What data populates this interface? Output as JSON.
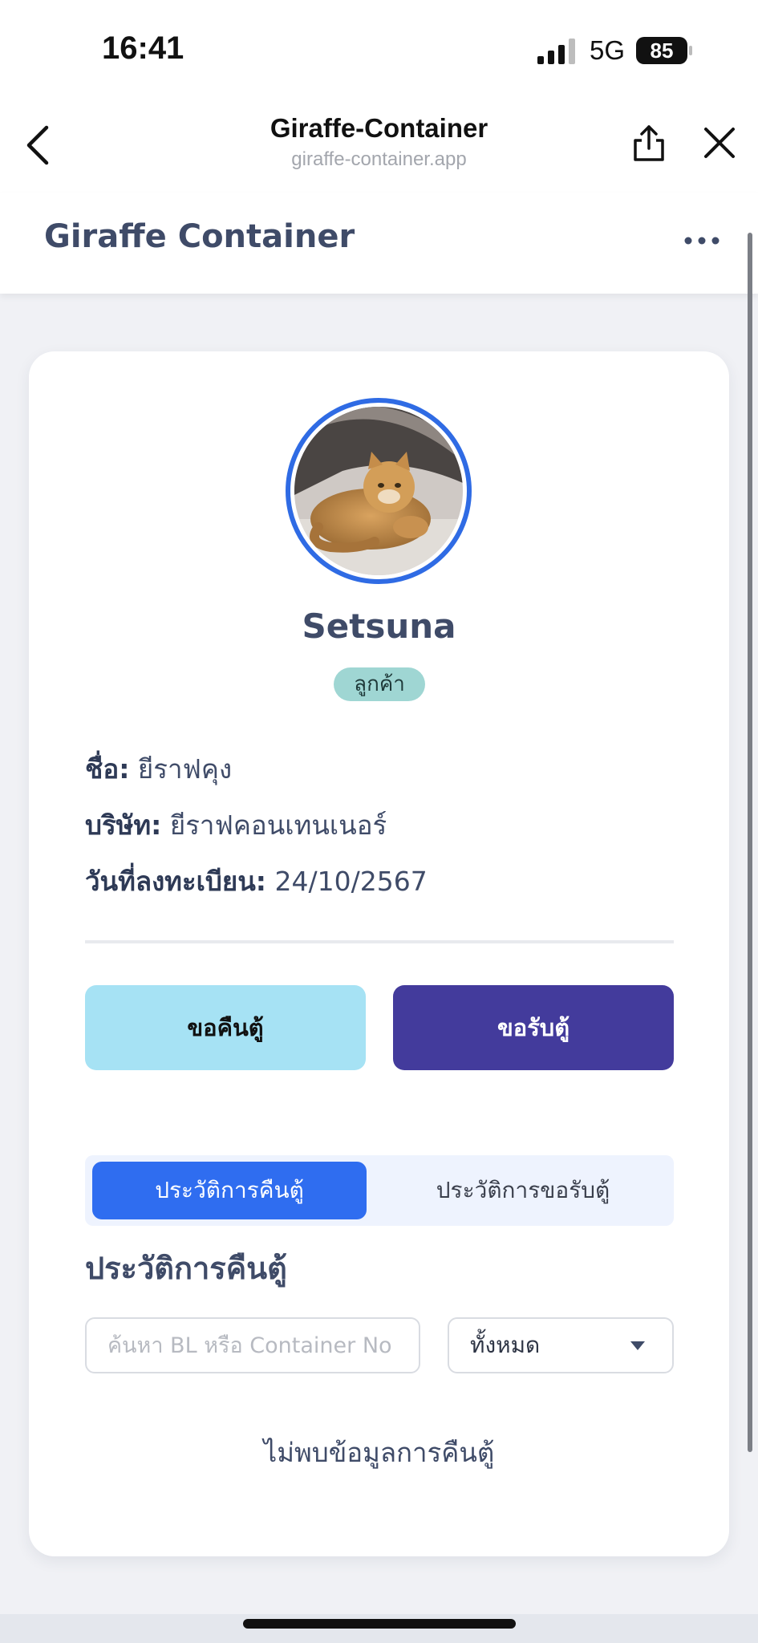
{
  "status_bar": {
    "time": "16:41",
    "network": "5G",
    "battery": "85"
  },
  "browser": {
    "title": "Giraffe-Container",
    "url": "giraffe-container.app",
    "icons": {
      "back": "chevron-left-icon",
      "share": "share-icon",
      "close": "close-icon"
    }
  },
  "app_header": {
    "title": "Giraffe Container",
    "more_icon": "more-horizontal-icon"
  },
  "profile": {
    "username": "Setsuna",
    "role": "ลูกค้า",
    "info": {
      "name_label": "ชื่อ:",
      "name_value": "ยีราฟคุง",
      "company_label": "บริษัท:",
      "company_value": "ยีราฟคอนเทนเนอร์",
      "registered_label": "วันที่ลงทะเบียน:",
      "registered_value": "24/10/2567"
    }
  },
  "actions": {
    "return_label": "ขอคืนตู้",
    "request_label": "ขอรับตู้"
  },
  "tabs": [
    {
      "label": "ประวัติการคืนตู้",
      "active": true
    },
    {
      "label": "ประวัติการขอรับตู้",
      "active": false
    }
  ],
  "history": {
    "title": "ประวัติการคืนตู้",
    "search_placeholder": "ค้นหา BL หรือ Container No",
    "filter_value": "ทั้งหมด",
    "empty_message": "ไม่พบข้อมูลการคืนตู้"
  },
  "colors": {
    "primary": "#2f6df0",
    "accent_purple": "#433b9c",
    "accent_light": "#a6e2f4",
    "badge": "#9fd6d3"
  }
}
